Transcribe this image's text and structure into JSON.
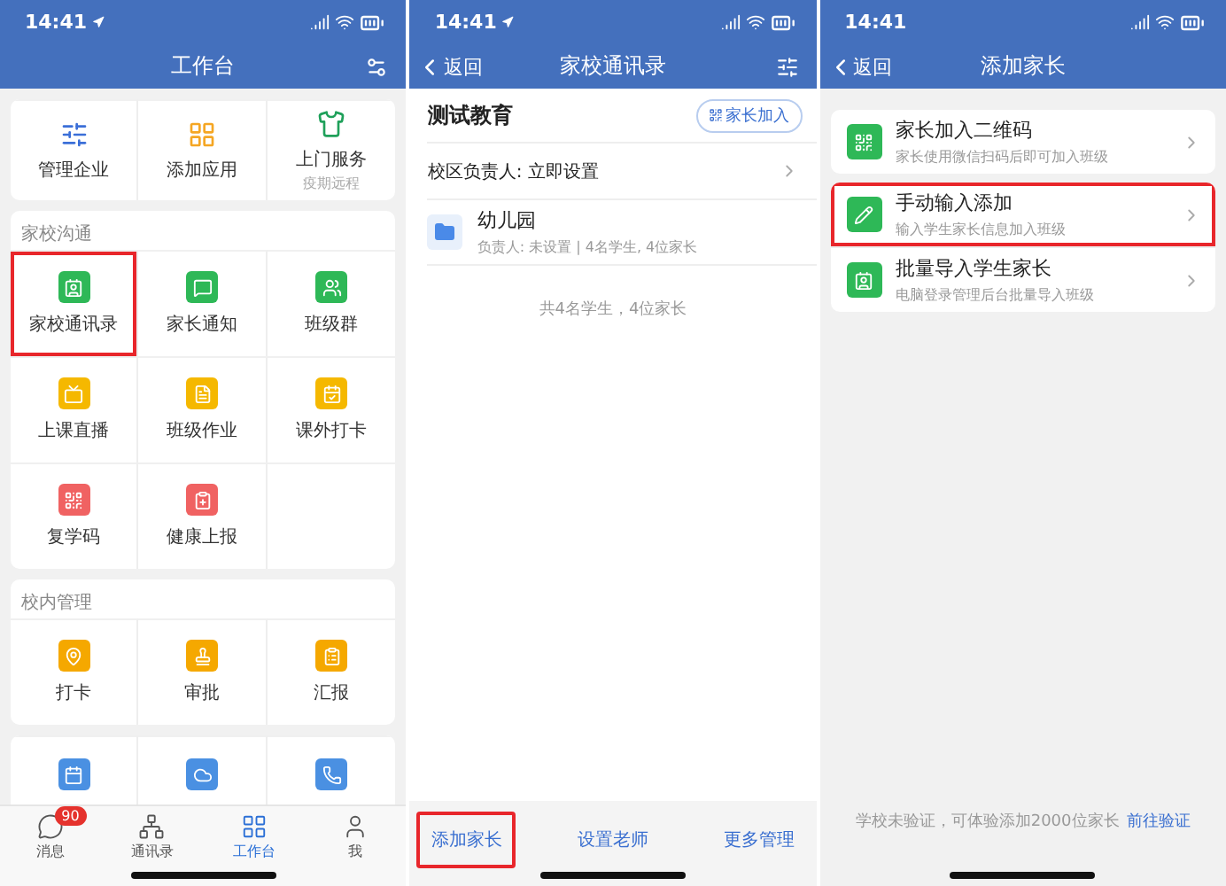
{
  "workbench": {
    "status": {
      "time": "14:41",
      "location": true
    },
    "title": "工作台",
    "top_apps": [
      {
        "label": "管理企业",
        "color": "#3b6fd8"
      },
      {
        "label": "添加应用",
        "color": "#f5a623"
      },
      {
        "label": "上门服务",
        "sublabel": "疫期远程",
        "color": "#1fa05a"
      }
    ],
    "sections": [
      {
        "title": "家校沟通",
        "items": [
          {
            "label": "家校通讯录",
            "color": "#2eb857",
            "highlighted": true
          },
          {
            "label": "家长通知",
            "color": "#2eb857",
            "highlighted": false
          },
          {
            "label": "班级群",
            "color": "#2eb857",
            "highlighted": false
          },
          {
            "label": "上课直播",
            "color": "#f5b800",
            "highlighted": false
          },
          {
            "label": "班级作业",
            "color": "#f5b800",
            "highlighted": false
          },
          {
            "label": "课外打卡",
            "color": "#f5b800",
            "highlighted": false
          },
          {
            "label": "复学码",
            "color": "#f06262",
            "highlighted": false
          },
          {
            "label": "健康上报",
            "color": "#f06262",
            "highlighted": false
          }
        ]
      },
      {
        "title": "校内管理",
        "items": [
          {
            "label": "打卡",
            "color": "#f5a800",
            "highlighted": false
          },
          {
            "label": "审批",
            "color": "#f5a800",
            "highlighted": false
          },
          {
            "label": "汇报",
            "color": "#f5a800",
            "highlighted": false
          }
        ]
      },
      {
        "items": [
          {
            "color": "#4a90e2",
            "highlighted": false
          },
          {
            "color": "#4a90e2",
            "highlighted": false
          },
          {
            "color": "#4a90e2",
            "highlighted": false
          }
        ]
      }
    ],
    "tab_bar": [
      {
        "label": "消息",
        "badge": "90",
        "selected": false
      },
      {
        "label": "通讯录",
        "selected": false
      },
      {
        "label": "工作台",
        "selected": true
      },
      {
        "label": "我",
        "selected": false
      }
    ]
  },
  "contacts": {
    "status": {
      "time": "14:41",
      "location": true
    },
    "back": "返回",
    "title": "家校通讯录",
    "org": {
      "name": "测试教育",
      "join_button": "家长加入"
    },
    "campus_row": "校区负责人: 立即设置",
    "groups": [
      {
        "name": "幼儿园",
        "detail": "负责人: 未设置 | 4名学生, 4位家长"
      }
    ],
    "summary": "共4名学生，4位家长",
    "actions": [
      {
        "label": "添加家长",
        "highlighted": true
      },
      {
        "label": "设置老师",
        "highlighted": false
      },
      {
        "label": "更多管理",
        "highlighted": false
      }
    ]
  },
  "add_parent": {
    "status": {
      "time": "14:41",
      "location": false
    },
    "back": "返回",
    "title": "添加家长",
    "cards": [
      [
        {
          "title": "家长加入二维码",
          "subtitle": "家长使用微信扫码后即可加入班级",
          "highlighted": false
        }
      ],
      [
        {
          "title": "手动输入添加",
          "subtitle": "输入学生家长信息加入班级",
          "highlighted": true
        },
        {
          "title": "批量导入学生家长",
          "subtitle": "电脑登录管理后台批量导入班级",
          "highlighted": false
        }
      ]
    ],
    "notice": "学校未验证，可体验添加2000位家长",
    "notice_link": "前往验证"
  }
}
